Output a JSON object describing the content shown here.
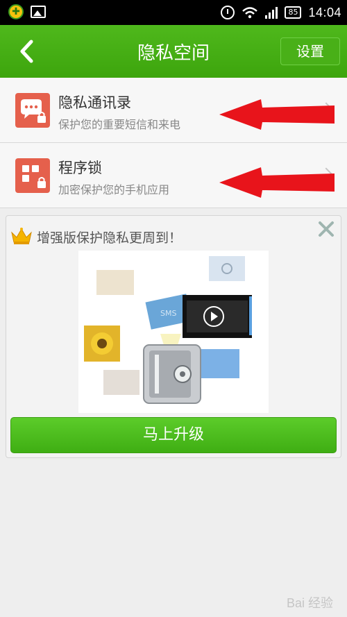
{
  "status_bar": {
    "battery": "85",
    "time": "14:04"
  },
  "header": {
    "title": "隐私空间",
    "settings_label": "设置"
  },
  "items": [
    {
      "title": "隐私通讯录",
      "subtitle": "保护您的重要短信和来电",
      "icon": "private-contacts-icon"
    },
    {
      "title": "程序锁",
      "subtitle": "加密保护您的手机应用",
      "icon": "app-lock-icon"
    }
  ],
  "promo": {
    "text": "增强版保护隐私更周到！",
    "button_label": "马上升级"
  },
  "watermark": "Bai 经验",
  "colors": {
    "header_green": "#3da50d",
    "accent_red": "#e5604c",
    "button_green": "#4cbf1e",
    "arrow_red": "#e8141b"
  }
}
